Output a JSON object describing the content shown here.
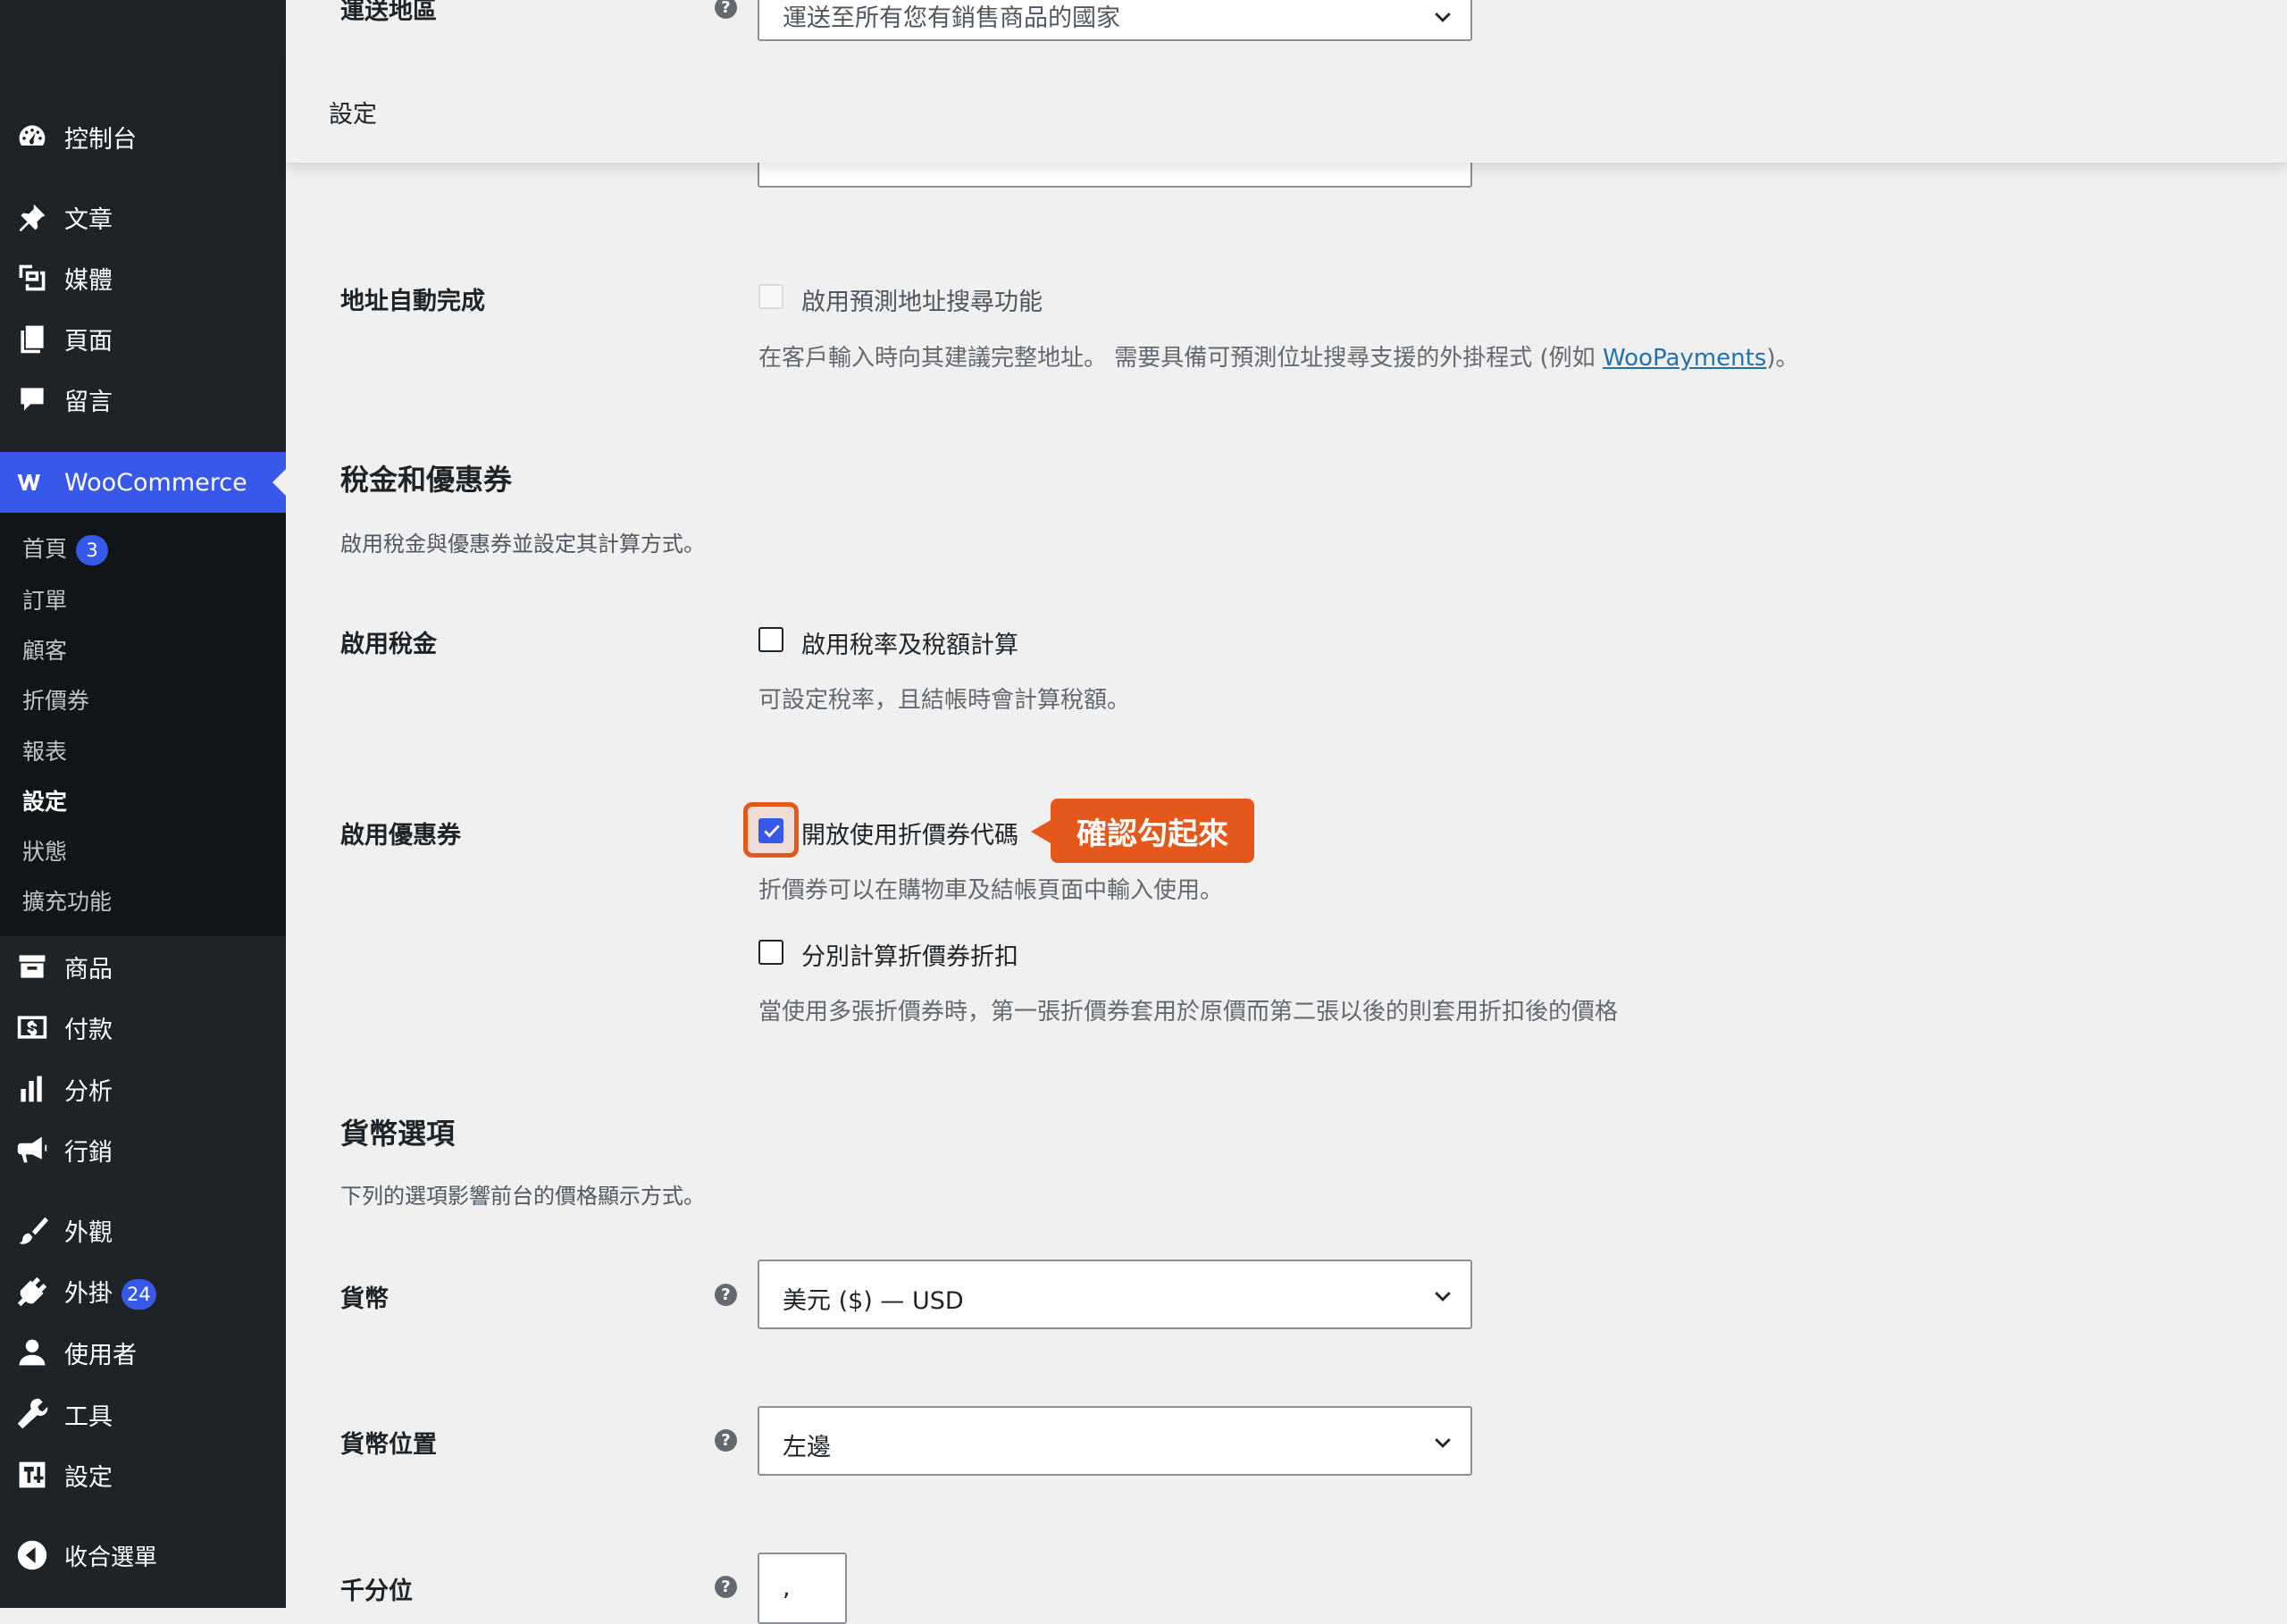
{
  "sidebar": {
    "items": [
      {
        "label": "控制台",
        "icon": "dashboard-icon"
      },
      {
        "label": "文章",
        "icon": "pin-icon"
      },
      {
        "label": "媒體",
        "icon": "media-icon"
      },
      {
        "label": "頁面",
        "icon": "pages-icon"
      },
      {
        "label": "留言",
        "icon": "comments-icon"
      },
      {
        "label": "WooCommerce",
        "icon": "woocommerce-icon"
      },
      {
        "label": "商品",
        "icon": "archive-icon"
      },
      {
        "label": "付款",
        "icon": "money-icon"
      },
      {
        "label": "分析",
        "icon": "chart-bar-icon"
      },
      {
        "label": "行銷",
        "icon": "megaphone-icon"
      },
      {
        "label": "外觀",
        "icon": "brush-icon"
      },
      {
        "label": "外掛",
        "icon": "plugin-icon"
      },
      {
        "label": "使用者",
        "icon": "user-icon"
      },
      {
        "label": "工具",
        "icon": "wrench-icon"
      },
      {
        "label": "設定",
        "icon": "settings-icon"
      },
      {
        "label": "收合選單",
        "icon": "collapse-icon"
      }
    ],
    "plugins_badge": "24",
    "submenu": [
      {
        "label": "首頁",
        "badge": "3"
      },
      {
        "label": "訂單"
      },
      {
        "label": "顧客"
      },
      {
        "label": "折價券"
      },
      {
        "label": "報表"
      },
      {
        "label": "設定"
      },
      {
        "label": "狀態"
      },
      {
        "label": "擴充功能"
      }
    ]
  },
  "header": {
    "title": "設定"
  },
  "top_partial": {
    "label": "運送地區",
    "select_value": "運送至所有您有銷售商品的國家"
  },
  "address_autocomplete": {
    "label": "地址自動完成",
    "checkbox_label": "啟用預測地址搜尋功能",
    "checked": false,
    "disabled": true,
    "desc_before": "在客戶輸入時向其建議完整地址。 需要具備可預測位址搜尋支援的外掛程式 (例如 ",
    "desc_link": "WooPayments",
    "desc_after": ")。"
  },
  "tax_section": {
    "title": "稅金和優惠券",
    "desc": "啟用稅金與優惠券並設定其計算方式。",
    "enable_tax": {
      "label": "啟用稅金",
      "checkbox_label": "啟用稅率及稅額計算",
      "checked": false,
      "desc": "可設定稅率，且結帳時會計算稅額。"
    },
    "enable_coupons": {
      "label": "啟用優惠券",
      "checkbox_label": "開放使用折價券代碼",
      "checked": true,
      "desc": "折價券可以在購物車及結帳頁面中輸入使用。",
      "sequential_label": "分別計算折價券折扣",
      "sequential_checked": false,
      "sequential_desc": "當使用多張折價券時，第一張折價券套用於原價而第二張以後的則套用折扣後的價格"
    },
    "callout": "確認勾起來"
  },
  "currency_section": {
    "title": "貨幣選項",
    "desc": "下列的選項影響前台的價格顯示方式。",
    "currency": {
      "label": "貨幣",
      "value": "美元 ($) — USD"
    },
    "currency_position": {
      "label": "貨幣位置",
      "value": "左邊"
    },
    "thousand_separator": {
      "label": "千分位",
      "value": ","
    }
  },
  "colors": {
    "sidebar_bg": "#1d2327",
    "submenu_bg": "#101517",
    "accent": "#3858e9",
    "callout": "#e5581b",
    "page_bg": "#f0f0f1"
  }
}
